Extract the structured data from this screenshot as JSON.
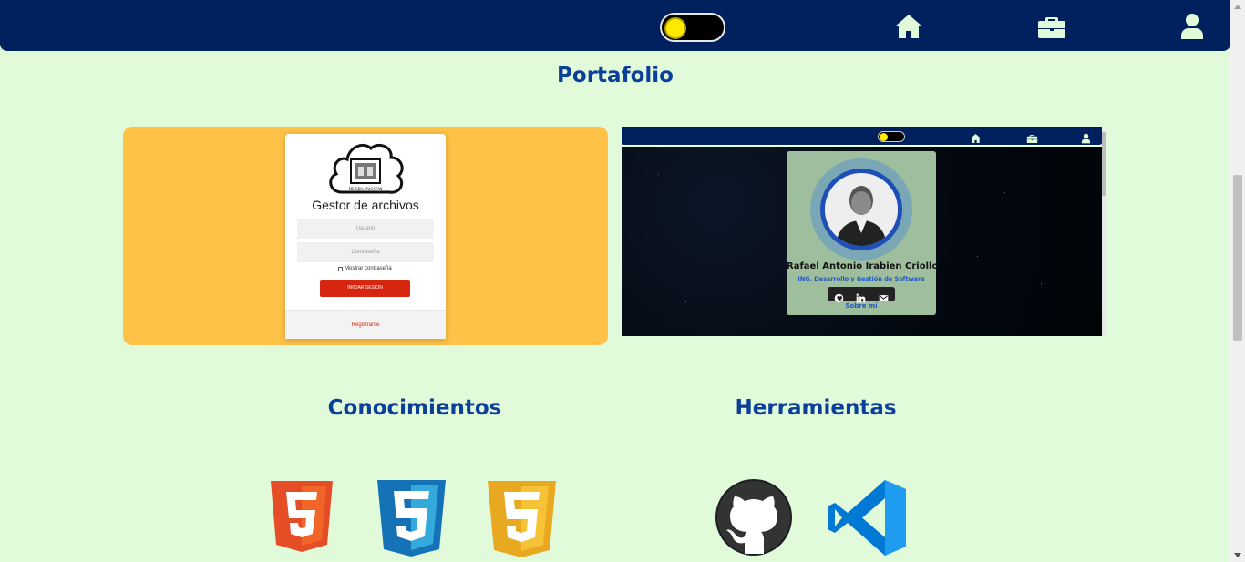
{
  "navbar": {
    "theme_toggle": {
      "state": "on",
      "knob_color": "#ffea00"
    },
    "icons": [
      "home-icon",
      "briefcase-icon",
      "user-icon"
    ],
    "background": "#00215e",
    "icon_color": "#e1fad9"
  },
  "sections": {
    "portfolio_title": "Portafolio",
    "knowledge_title": "Conocimientos",
    "tools_title": "Herramientas"
  },
  "projects": [
    {
      "preview": "file-manager-login",
      "background": "#ffc247",
      "login": {
        "title": "Gestor de archivos",
        "user_placeholder": "Usuario",
        "password_placeholder": "Contraseña",
        "show_password_label": "Mostrar contraseña",
        "submit_label": "INICIAR SESION",
        "register_label": "Registrarse"
      }
    },
    {
      "preview": "personal-portfolio",
      "profile": {
        "name": "Rafael Antonio Irabien Criollo",
        "role": "ING. Desarrollo y Gestión de Software",
        "social_icons": [
          "github-icon",
          "linkedin-icon",
          "mail-icon"
        ],
        "about_link": "Sobre mí"
      }
    }
  ],
  "knowledge": [
    "html5-icon",
    "css3-icon",
    "javascript-icon"
  ],
  "tools": [
    "github-icon",
    "vscode-icon"
  ],
  "colors": {
    "page_bg": "#e1fad9",
    "heading": "#0b3f9a",
    "accent_red": "#d6260f"
  }
}
